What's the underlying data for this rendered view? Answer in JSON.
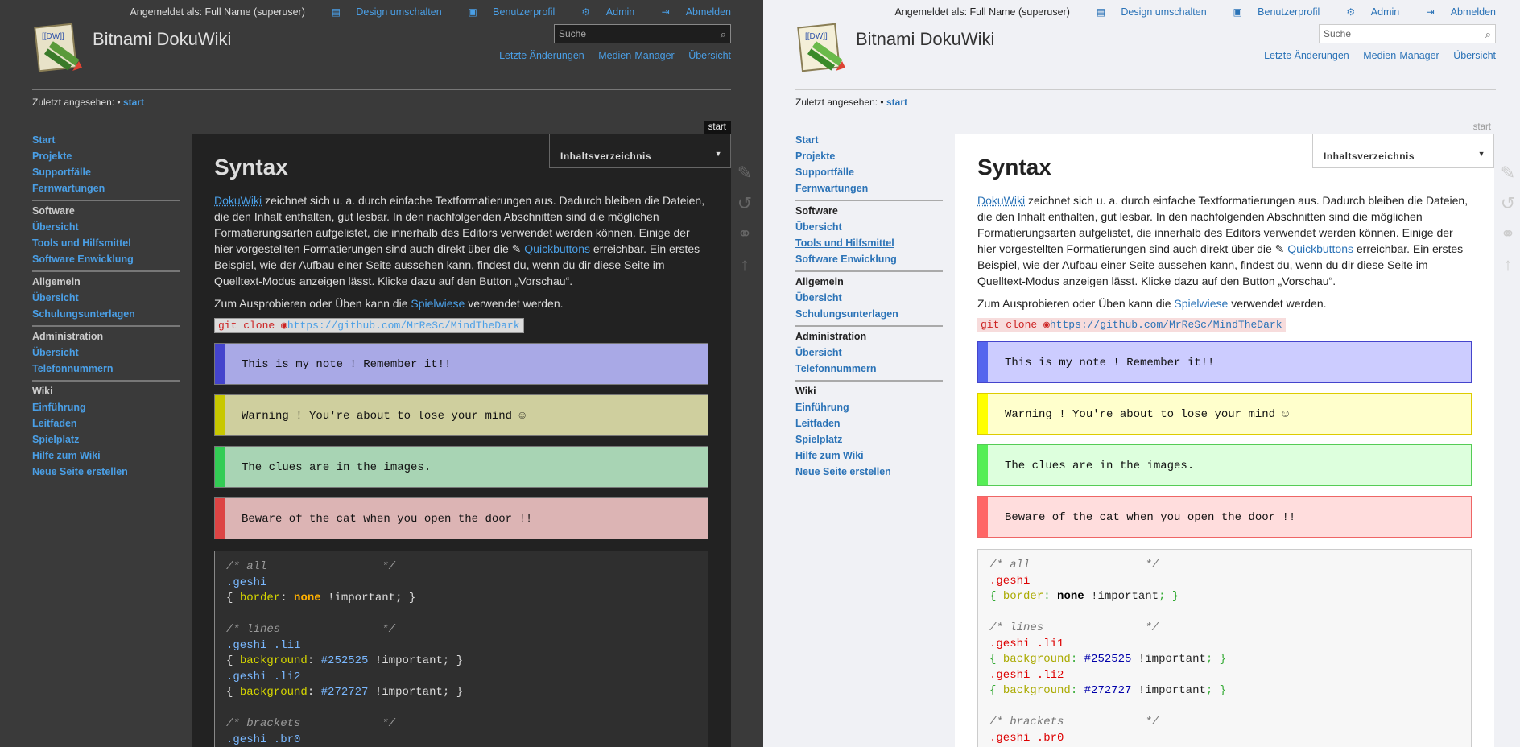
{
  "user": {
    "logged_in_label": "Angemeldet als: Full Name (superuser)",
    "links": [
      {
        "label": "Design umschalten",
        "icon": "theme-toggle-icon"
      },
      {
        "label": "Benutzerprofil",
        "icon": "profile-icon"
      },
      {
        "label": "Admin",
        "icon": "gear-icon"
      },
      {
        "label": "Abmelden",
        "icon": "logout-icon"
      }
    ]
  },
  "site": {
    "title": "Bitnami DokuWiki",
    "logo_text": "[[DW]]"
  },
  "search": {
    "placeholder": "Suche"
  },
  "toplinks": [
    "Letzte Änderungen",
    "Medien-Manager",
    "Übersicht"
  ],
  "breadcrumb": {
    "label": "Zuletzt angesehen:",
    "separator": "•",
    "page": "start"
  },
  "page_id": "start",
  "sidebar": {
    "top_items": [
      "Start",
      "Projekte",
      "Supportfälle",
      "Fernwartungen"
    ],
    "groups": [
      {
        "title": "Software",
        "items": [
          "Übersicht",
          "Tools und Hilfsmittel",
          "Software Enwicklung"
        ]
      },
      {
        "title": "Allgemein",
        "items": [
          "Übersicht",
          "Schulungsunterlagen"
        ]
      },
      {
        "title": "Administration",
        "items": [
          "Übersicht",
          "Telefonnummern"
        ]
      },
      {
        "title": "Wiki",
        "items": [
          "Einführung",
          "Leitfaden",
          "Spielplatz",
          "Hilfe zum Wiki",
          "Neue Seite erstellen"
        ]
      }
    ]
  },
  "toc": {
    "label": "Inhaltsverzeichnis"
  },
  "content": {
    "heading": "Syntax",
    "intro_link": "DokuWiki",
    "intro_text_1": " zeichnet sich u. a. durch einfache Textformatierungen aus. Dadurch bleiben die Dateien, die den Inhalt enthalten, gut lesbar. In den nachfolgenden Abschnitten sind die möglichen Formatierungsarten aufgelistet, die innerhalb des Editors verwendet werden können. Einige der hier vorgestellten Formatierungen sind auch direkt über die ",
    "quickbuttons": "Quickbuttons",
    "intro_text_2": " erreichbar. Ein erstes Beispiel, wie der Aufbau einer Seite aussehen kann, findest du, wenn du dir diese Seite im Quelltext-Modus anzeigen lässt. Klicke dazu auf den Button „Vorschau“.",
    "try_prefix": "Zum Ausprobieren oder Üben kann die ",
    "try_link": "Spielwiese",
    "try_suffix": " verwendet werden.",
    "git_cmd": "git clone",
    "git_url": "https://github.com/MrReSc/MindTheDark",
    "notes": [
      {
        "type": "blue",
        "text": "This is my note ! Remember it!!"
      },
      {
        "type": "yellow",
        "text": "Warning ! You're about to lose your mind ☺"
      },
      {
        "type": "green",
        "text": "The clues are in the images."
      },
      {
        "type": "red",
        "text": "Beware of the cat when you open the door !!"
      }
    ],
    "code": {
      "c1": "/* all                 */",
      "s1": ".geshi",
      "p1": "border",
      "k1": "none",
      "imp": "!important",
      "c2": "/* lines               */",
      "s2": ".geshi .li1",
      "p2": "background",
      "v2": "#252525",
      "s3": ".geshi .li2",
      "v3": "#272727",
      "c3": "/* brackets            */",
      "s4": ".geshi .br0"
    }
  },
  "tools": [
    "edit-icon",
    "history-icon",
    "backlinks-icon",
    "back-to-top-icon"
  ]
}
